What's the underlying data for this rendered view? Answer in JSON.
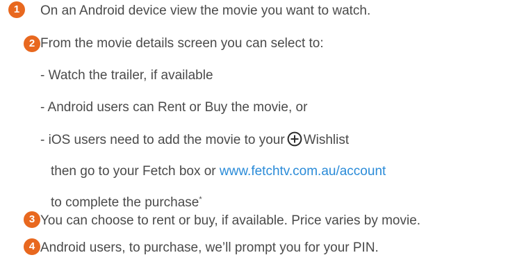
{
  "steps": [
    {
      "number": "1",
      "text": "On an Android device view the movie you want to watch."
    },
    {
      "number": "2",
      "text": "From the movie details screen you can select to:"
    },
    {
      "number": "3",
      "text": "You can choose to rent or buy, if available. Price varies by movie."
    },
    {
      "number": "4",
      "text": "Android users, to purchase, we’ll prompt you for your PIN."
    }
  ],
  "options": {
    "trailer": "- Watch the trailer, if available",
    "android": "- Android users can Rent or Buy the movie, or",
    "ios_before": "- iOS users need to add the movie to your",
    "ios_after": "Wishlist",
    "ios_line2_before": "then go to your Fetch box or",
    "link": "www.fetchtv.com.au/account",
    "ios_line3": "to complete the purchase",
    "footnote_mark": "*"
  },
  "icons": {
    "step_badge": "numbered-circle",
    "wishlist": "plus-circle-icon"
  },
  "colors": {
    "badge": "#e8681f",
    "text": "#4a4a4a",
    "link": "#2a8bd8"
  }
}
